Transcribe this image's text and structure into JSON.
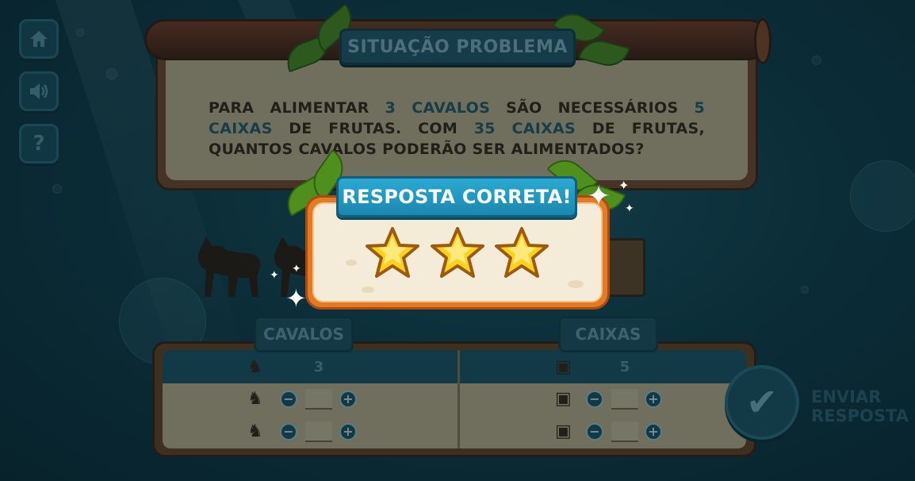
{
  "sidebar": {
    "home_icon": "home-icon",
    "sound_icon": "speaker-icon",
    "help_label": "?"
  },
  "problem": {
    "title": "SITUAÇÃO PROBLEMA",
    "text_parts": [
      "PARA ALIMENTAR ",
      "3 CAVALOS",
      " SÃO NECESSÁRIOS ",
      "5 CAIXAS",
      " DE FRUTAS. COM ",
      "35 CAIXAS",
      " DE FRUTAS, QUANTOS CAVALOS PODERÃO SER ALIMENTADOS?"
    ]
  },
  "table": {
    "col_horses": "CAVALOS",
    "col_boxes": "CAIXAS",
    "horses_first_value": "3",
    "boxes_first_value": "5",
    "minus_label": "−",
    "plus_label": "+"
  },
  "send": {
    "label_line1": "ENVIAR",
    "label_line2": "RESPOSTA"
  },
  "result": {
    "title": "RESPOSTA CORRETA!",
    "stars_earned": 3,
    "stars_total": 3
  },
  "colors": {
    "highlight": "#2a5b6b",
    "popup_orange": "#e47a26",
    "title_blue": "#1b88b0",
    "star_gold": "#ffd21c"
  }
}
